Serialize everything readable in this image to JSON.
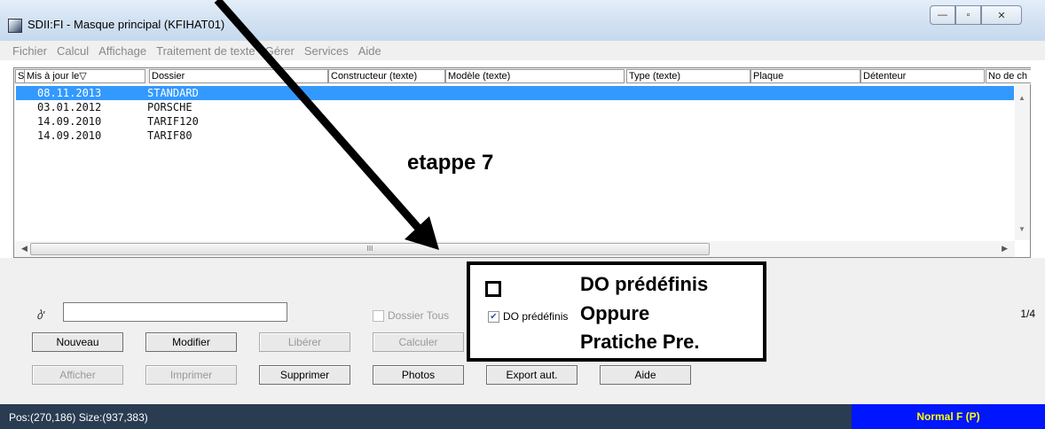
{
  "window": {
    "title": "SDII:FI - Masque principal (KFIHAT01)",
    "buttons": [
      "—",
      "▫",
      "✕"
    ]
  },
  "menu": [
    "Fichier",
    "Calcul",
    "Affichage",
    "Traitement de texte",
    "Gérer",
    "Services",
    "Aide"
  ],
  "grid": {
    "headers": [
      "S",
      "Mis à jour le▽",
      "Dossier",
      "Constructeur (texte)",
      "Modèle (texte)",
      "Type (texte)",
      "Plaque",
      "Détenteur",
      "No de ch"
    ],
    "rows": [
      {
        "date": "08.11.2013",
        "dossier": "STANDARD"
      },
      {
        "date": "03.01.2012",
        "dossier": "PORSCHE"
      },
      {
        "date": "14.09.2010",
        "dossier": "TARIF120"
      },
      {
        "date": "14.09.2010",
        "dossier": "TARIF80"
      }
    ],
    "selected_row": 0,
    "scroll_thumb": "III"
  },
  "panel": {
    "search_value": "",
    "dossier_tous": "Dossier Tous",
    "do_predefinis": "DO prédéfinis",
    "page": "1/4",
    "row1": [
      "Nouveau",
      "Modifier",
      "Libérer",
      "Calculer"
    ],
    "row2": [
      "Afficher",
      "Imprimer",
      "Supprimer",
      "Photos",
      "Export aut.",
      "Aide"
    ]
  },
  "status": {
    "position": "Pos:(270,186) Size:(937,383)",
    "mode": "Normal F (P)"
  },
  "annotations": {
    "step": "etappe 7",
    "callout_lines": [
      "DO prédéfinis",
      "Oppure",
      "Pratiche Pre."
    ]
  }
}
